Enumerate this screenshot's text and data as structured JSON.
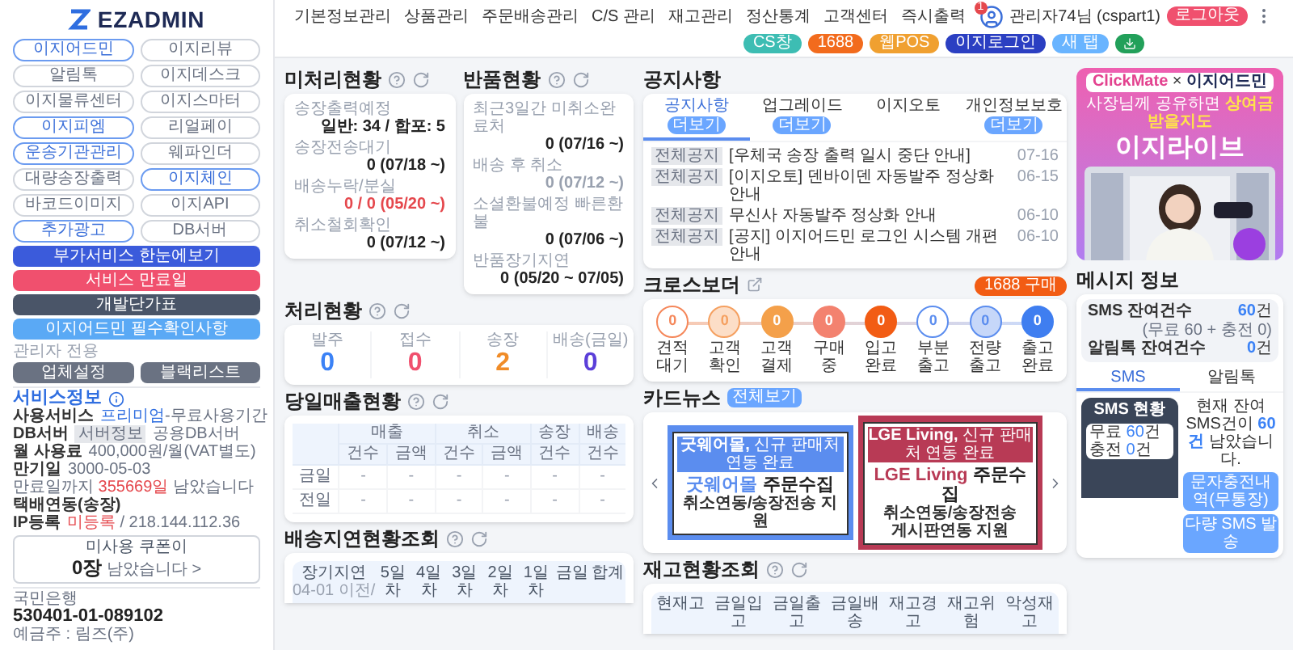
{
  "sidebar": {
    "logo": "EZADMIN",
    "services": [
      {
        "label": "이지어드민",
        "active": true
      },
      {
        "label": "이지리뷰",
        "active": false
      },
      {
        "label": "알림톡",
        "active": false
      },
      {
        "label": "이지데스크",
        "active": false
      },
      {
        "label": "이지물류센터",
        "active": false
      },
      {
        "label": "이지스마터",
        "active": false
      },
      {
        "label": "이지피엠",
        "active": true
      },
      {
        "label": "리얼페이",
        "active": false
      },
      {
        "label": "운송기관관리",
        "active": true
      },
      {
        "label": "웨파인더",
        "active": false
      },
      {
        "label": "대량송장출력",
        "active": false
      },
      {
        "label": "이지체인",
        "active": true
      },
      {
        "label": "바코드이미지",
        "active": false
      },
      {
        "label": "이지API",
        "active": false
      },
      {
        "label": "추가광고",
        "active": true
      },
      {
        "label": "DB서버",
        "active": false
      }
    ],
    "buttons": [
      {
        "label": "부가서비스 한눈에보기",
        "color": "#3b5bdb"
      },
      {
        "label": "서비스 만료일",
        "color": "#f0506e"
      },
      {
        "label": "개발단가표",
        "color": "#4a5568"
      },
      {
        "label": "이지어드민 필수확인사항",
        "color": "#5aa9f5"
      }
    ],
    "admin_title": "관리자 전용",
    "admin_buttons": [
      "업체설정",
      "블랙리스트"
    ],
    "service_info": {
      "title": "서비스정보",
      "usage_label": "사용서비스",
      "usage_plan": "프리미엄",
      "usage_rest": "-무료사용기간",
      "db_label": "DB서버",
      "db_chip": "서버정보",
      "db_value": "공용DB서버",
      "fee_label": "월 사용료",
      "fee_value": "400,000원/월(VAT별도)",
      "expiry_label": "만기일",
      "expiry_date": "3000-05-03",
      "remain_pre": "만료일까지",
      "remain_days": "355669일",
      "remain_post": "남았습니다",
      "courier": "택배연동(송장)",
      "ip_label": "IP등록",
      "ip_status": "미등록",
      "ip_value": "/ 218.144.112.36"
    },
    "coupon": {
      "line1": "미사용 쿠폰이",
      "count": "0장",
      "rest": "남았습니다 >"
    },
    "bank": {
      "name": "국민은행",
      "account": "530401-01-089102",
      "holder": "예금주 : 림즈(주)"
    }
  },
  "nav": [
    "기본정보관리",
    "상품관리",
    "주문배송관리",
    "C/S 관리",
    "재고관리",
    "정산통계",
    "고객센터",
    "즉시출력"
  ],
  "quick_buttons": [
    {
      "kind": "text",
      "label": "CS창",
      "color": "#3dbdb3"
    },
    {
      "kind": "text",
      "label": "1688",
      "color": "#f26b1d"
    },
    {
      "kind": "text",
      "label": "웹POS",
      "color": "#f0a030"
    },
    {
      "kind": "text",
      "label": "이지로그인",
      "color": "#2b3fc2"
    },
    {
      "kind": "text",
      "label": "새 탭",
      "color": "#69b4ff"
    },
    {
      "kind": "download",
      "color": "#22a05a"
    }
  ],
  "user": {
    "notifications": "1",
    "name": "관리자74님 (cspart1)",
    "logout": "로그아웃"
  },
  "unprocessed": {
    "title": "미처리현황",
    "rows": [
      {
        "label": "송장출력예정",
        "value": "일반: 34 / 합포: 5",
        "alert": false,
        "muted": false
      },
      {
        "label": "송장전송대기",
        "value": "0 (07/18 ~)",
        "alert": false,
        "muted": false
      },
      {
        "label": "배송누락/분실",
        "value": "0 / 0 (05/20 ~)",
        "alert": true,
        "muted": false
      },
      {
        "label": "취소철회확인",
        "value": "0 (07/12 ~)",
        "alert": false,
        "muted": false
      }
    ]
  },
  "returns": {
    "title": "반품현황",
    "rows": [
      {
        "label": "최근3일간 미취소완료처",
        "value": "0 (07/16 ~)",
        "alert": false,
        "muted": false
      },
      {
        "label": "배송 후 취소",
        "value": "0 (07/12 ~)",
        "alert": false,
        "muted": true
      },
      {
        "label": "소셜환불예정 빠른환불",
        "value": "0 (07/06 ~)",
        "alert": false,
        "muted": false
      },
      {
        "label": "반품장기지연",
        "value": "0 (05/20 ~ 07/05)",
        "alert": false,
        "muted": false
      }
    ]
  },
  "processing": {
    "title": "처리현황",
    "items": [
      {
        "label": "발주",
        "value": "0",
        "color": "#3b82f6"
      },
      {
        "label": "접수",
        "value": "0",
        "color": "#f0506e"
      },
      {
        "label": "송장",
        "value": "2",
        "color": "#f08c28"
      },
      {
        "label": "배송(금일)",
        "value": "0",
        "color": "#5b3fd9"
      }
    ]
  },
  "sales_today": {
    "title": "당일매출현황",
    "groups": [
      {
        "label": "매출",
        "columns": [
          "건수",
          "금액"
        ]
      },
      {
        "label": "취소",
        "columns": [
          "건수",
          "금액"
        ]
      },
      {
        "label": "송장",
        "columns": [
          "건수"
        ]
      },
      {
        "label": "배송",
        "columns": [
          "건수"
        ]
      }
    ],
    "rows": [
      {
        "label": "금일",
        "cells": [
          "-",
          "-",
          "-",
          "-",
          "-",
          "-"
        ]
      },
      {
        "label": "전일",
        "cells": [
          "-",
          "-",
          "-",
          "-",
          "-",
          "-"
        ]
      }
    ]
  },
  "delivery_delay": {
    "title": "배송지연현황조회",
    "columns": [
      {
        "label": "장기지연",
        "sub": "04-01 이전/"
      },
      {
        "label": "5일차"
      },
      {
        "label": "4일차"
      },
      {
        "label": "3일차"
      },
      {
        "label": "2일차"
      },
      {
        "label": "1일차"
      },
      {
        "label": "금일"
      },
      {
        "label": "합계"
      }
    ]
  },
  "notices": {
    "title": "공지사항",
    "tabs": [
      {
        "label": "공지사항",
        "more": "더보기",
        "selected": true
      },
      {
        "label": "업그레이드",
        "more": "더보기",
        "selected": false
      },
      {
        "label": "이지오토",
        "selected": false
      },
      {
        "label": "개인정보보호",
        "more": "더보기",
        "selected": false
      }
    ],
    "rows": [
      {
        "tag": "전체공지",
        "title": "[우체국 송장 출력 일시 중단 안내]",
        "date": "07-16"
      },
      {
        "tag": "전체공지",
        "title": "[이지오토] 덴바이덴 자동발주 정상화 안내",
        "date": "06-15"
      },
      {
        "tag": "전체공지",
        "title": "무신사 자동발주 정상화 안내",
        "date": "06-10"
      },
      {
        "tag": "전체공지",
        "title": "[공지] 이지어드민 로그인 시스템 개편 안내",
        "date": "06-10"
      }
    ]
  },
  "crossborder": {
    "title": "크로스보더",
    "buy_button": "1688 구매",
    "steps": [
      {
        "label": "견적대기",
        "value": "0",
        "kind": "outline",
        "color": "#f5875a"
      },
      {
        "label": "고객확인",
        "value": "0",
        "kind": "light",
        "color": "#f5a060"
      },
      {
        "label": "고객결제",
        "value": "0",
        "kind": "solid",
        "color": "#f4a04a"
      },
      {
        "label": "구매중",
        "value": "0",
        "kind": "solid",
        "color": "#f3826f"
      },
      {
        "label": "입고완료",
        "value": "0",
        "kind": "solid",
        "color": "#f25c14"
      },
      {
        "label": "부분출고",
        "value": "0",
        "kind": "outline",
        "color": "#5b8def"
      },
      {
        "label": "전량출고",
        "value": "0",
        "kind": "light",
        "color": "#5b8def"
      },
      {
        "label": "출고완료",
        "value": "0",
        "kind": "solid",
        "color": "#3f7ef0"
      }
    ]
  },
  "card_news": {
    "title": "카드뉴스",
    "more": "전체보기",
    "cards": [
      {
        "color": "#5b8def",
        "tag": "**굿웨어몰,** 신규 판매처 연동 완료",
        "highlight": "굿웨어몰",
        "headline": "주문수집",
        "lines": [
          "취소연동/송장전송 지원"
        ]
      },
      {
        "color": "#b83a55",
        "tag": "**LGE Living,** 신규 판매처 연동 완료",
        "highlight": "LGE Living",
        "headline": "주문수집",
        "lines": [
          "취소연동/송장전송",
          "게시판연동 지원"
        ]
      }
    ]
  },
  "stock": {
    "title": "재고현황조회",
    "columns": [
      "현재고",
      "금일입고",
      "금일출고",
      "금일배송",
      "재고경고",
      "재고위험",
      "악성재고"
    ]
  },
  "ad": {
    "brand": "ClickMate",
    "separator": "×",
    "partner": "이지어드민",
    "tagline_pre": "사장님께 공유하면",
    "tagline_em": "상여금 받을지도",
    "title": "이지라이브"
  },
  "messages": {
    "title": "메시지 정보",
    "sms_label": "SMS 잔여건수",
    "sms_count": "60",
    "sms_unit": "건",
    "sms_detail": "(무료 60 + 충전 0)",
    "talk_label": "알림톡 잔여건수",
    "talk_count": "0",
    "talk_unit": "건",
    "tabs": [
      {
        "label": "SMS",
        "selected": true
      },
      {
        "label": "알림톡",
        "selected": false
      }
    ],
    "phone_title": "SMS 현황",
    "phone_rows": [
      {
        "label": "무료",
        "count": "60",
        "unit": "건"
      },
      {
        "label": "충전",
        "count": "0",
        "unit": "건"
      }
    ],
    "summary_pre": "현재 잔여 SMS건이",
    "summary_count": "60건",
    "summary_post": "남았습니다.",
    "buttons": [
      "문자충전내역(무통장)",
      "다량 SMS 발송"
    ]
  }
}
